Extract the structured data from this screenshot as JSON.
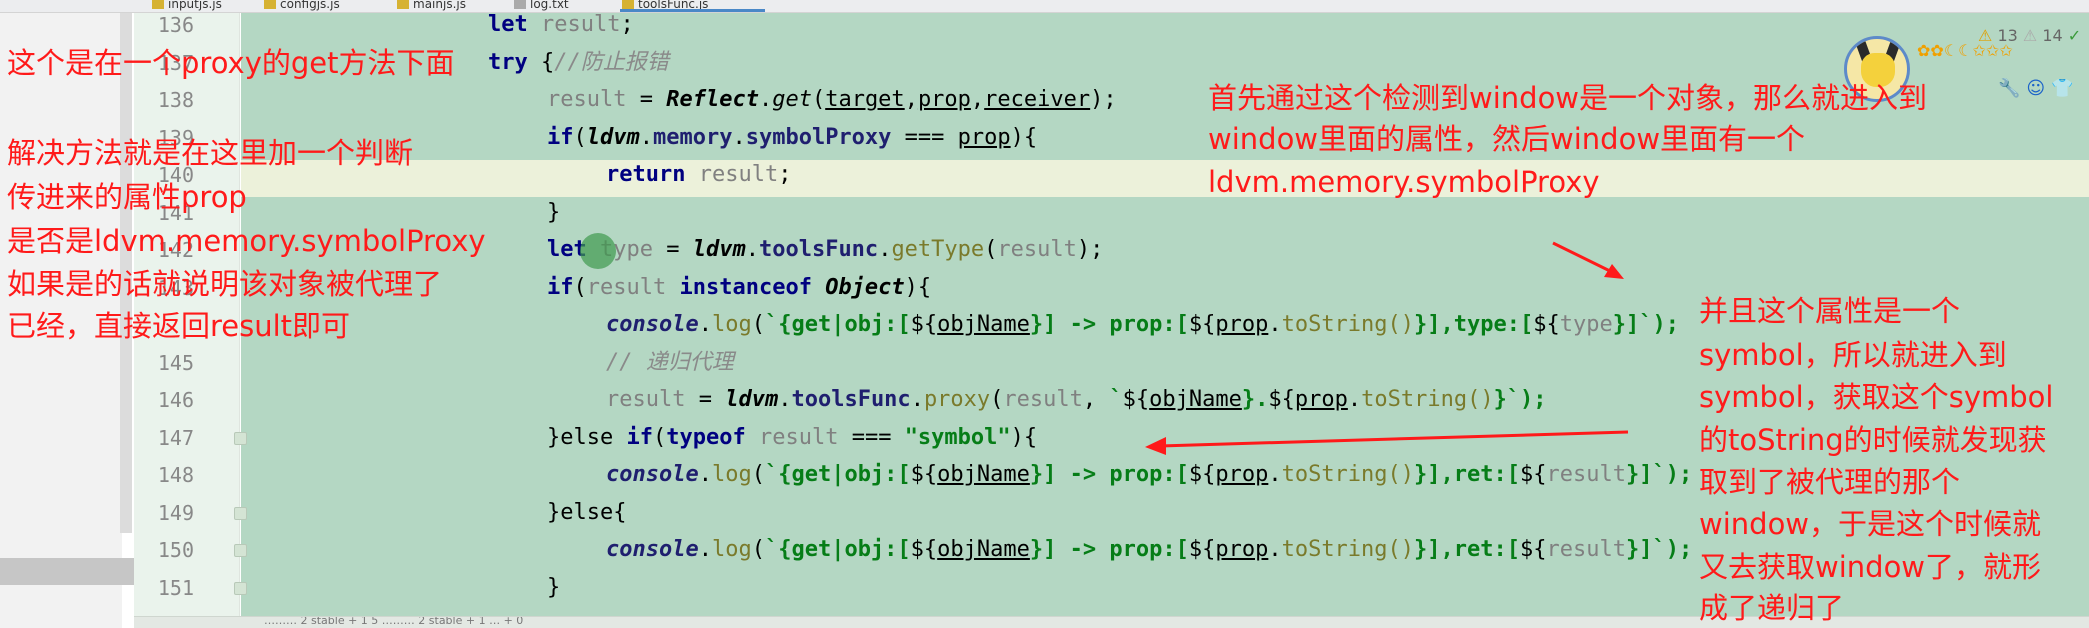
{
  "tabs": [
    {
      "label": "inputjs.js",
      "active": false
    },
    {
      "label": "configjs.js",
      "active": false
    },
    {
      "label": "mainjs.js",
      "active": false
    },
    {
      "label": "log.txt",
      "active": false
    },
    {
      "label": "toolsFunc.js",
      "active": true
    }
  ],
  "code_lines": [
    {
      "num": "136"
    },
    {
      "num": "137"
    },
    {
      "num": "138"
    },
    {
      "num": "139"
    },
    {
      "num": "140"
    },
    {
      "num": "141"
    },
    {
      "num": "142"
    },
    {
      "num": "143"
    },
    {
      "num": "144"
    },
    {
      "num": "145"
    },
    {
      "num": "146"
    },
    {
      "num": "147"
    },
    {
      "num": "148"
    },
    {
      "num": "149"
    },
    {
      "num": "150"
    },
    {
      "num": "151"
    }
  ],
  "tokens": {
    "let": "let",
    "result": "result",
    "semi": ";",
    "try": "try",
    "brace_open": "{",
    "brace_close": "}",
    "comment_1": "//防止报错",
    "comment_2": "// 递归代理",
    "eq": " = ",
    "Reflect": "Reflect",
    "dot": ".",
    "get": "get",
    "lparen": "(",
    "rparen": ")",
    "target": "target",
    "prop": "prop",
    "receiver": "receiver",
    "comma": ",",
    "comma_sp": ", ",
    "if": "if",
    "ldvm": "ldvm",
    "memory": "memory",
    "symbolProxy": "symbolProxy",
    "triple_eq": " === ",
    "paren_brace": "){",
    "return": "return",
    "type": "type",
    "toolsFunc": "toolsFunc",
    "getType": "getType",
    "instanceof": "instanceof",
    "Object": "Object",
    "console": "console",
    "log": "log",
    "tick": "`",
    "tpl_get_obj": "{get|obj:[",
    "dollar_brace": "${",
    "objName": "objName",
    "tpl_prop": "}] -> prop:[",
    "toString_call": "toString()",
    "tpl_type": "}],type:[",
    "type_var": "type",
    "tpl_end_1": "}]`);",
    "proxy": "proxy",
    "tpl_dot": "}.",
    "tpl_close_proxy": "}`);",
    "else": "else",
    "typeof": "typeof",
    "symbol_str": "\"symbol\"",
    "tpl_ret": "}],ret:[",
    "tpl_end_2": "}]`);",
    "else_brace": "}else{",
    "else_if": "}else "
  },
  "notes": {
    "left_title": "这个是在一个proxy的get方法下面",
    "left_body": [
      "解决方法就是在这里加一个判断",
      "传进来的属性prop",
      "是否是ldvm.memory.symbolProxy",
      "如果是的话就说明该对象被代理了",
      "已经，直接返回result即可"
    ],
    "top_right": [
      "首先通过这个检测到window是一个对象，那么就进入到",
      "window里面的属性，然后window里面有一个",
      "ldvm.memory.symbolProxy"
    ],
    "bottom_right": [
      "并且这个属性是一个",
      "symbol，所以就进入到",
      "symbol，获取这个symbol",
      "的toString的时候就发现获",
      "取到了被代理的那个",
      "window，于是这个时候就",
      "又去获取window了，就形",
      "成了递归了"
    ]
  },
  "status": {
    "warnings": "13",
    "weak_warnings": "14",
    "bar_text": "………  2 stable  + 1  5 ………  2 stable  + 1  …  + 0"
  },
  "colors": {
    "annotation": "#ff1a1a",
    "editor_selection": "#b4d7c3",
    "keyword": "#000080",
    "string": "#067d17"
  },
  "icons": [
    "js-file-icon",
    "fold-marker-icon",
    "warning-icon",
    "avatar-icon",
    "wrench-icon",
    "smile-icon",
    "shirt-icon"
  ]
}
